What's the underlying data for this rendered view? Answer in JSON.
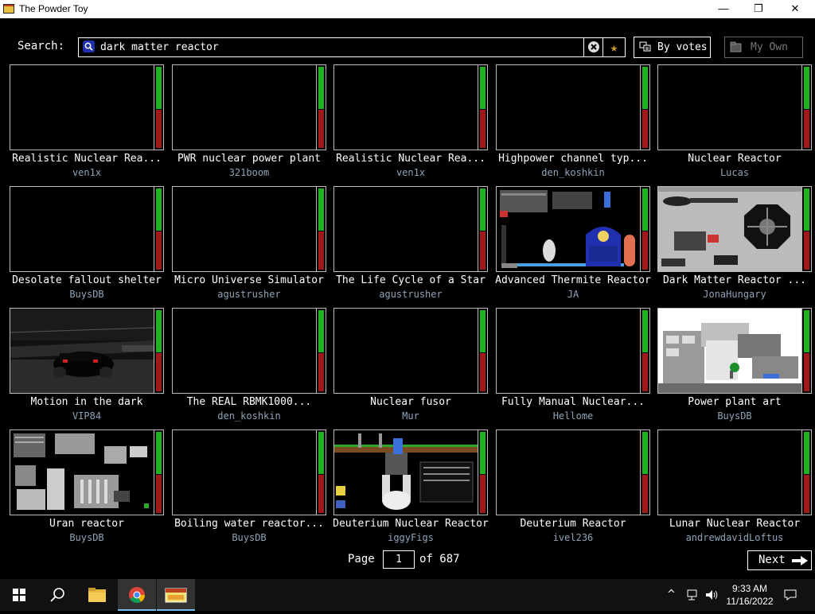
{
  "window": {
    "title": "The Powder Toy",
    "minimize": "—",
    "maximize": "❐",
    "close": "✕"
  },
  "search": {
    "label": "Search:",
    "query": "dark matter reactor",
    "sort_label": "By votes",
    "own_label": "My Own",
    "fav_glyph": "★"
  },
  "saves": [
    {
      "title": "Realistic Nuclear Rea...",
      "author": "ven1x",
      "thumb": "blank"
    },
    {
      "title": "PWR nuclear power plant",
      "author": "321boom",
      "thumb": "blank"
    },
    {
      "title": "Realistic Nuclear Rea...",
      "author": "ven1x",
      "thumb": "blank"
    },
    {
      "title": "Highpower channel typ...",
      "author": "den_koshkin",
      "thumb": "blank"
    },
    {
      "title": "Nuclear Reactor",
      "author": "Lucas",
      "thumb": "blank"
    },
    {
      "title": "Desolate fallout shelter",
      "author": "BuysDB",
      "thumb": "blank"
    },
    {
      "title": "Micro Universe Simulator",
      "author": "agustrusher",
      "thumb": "blank"
    },
    {
      "title": "The Life Cycle of a Star",
      "author": "agustrusher",
      "thumb": "blank"
    },
    {
      "title": "Advanced Thermite Reactor",
      "author": "JA",
      "thumb": "thermite-reactor"
    },
    {
      "title": "Dark Matter Reactor ...",
      "author": "JonaHungary",
      "thumb": "dark-matter-reactor"
    },
    {
      "title": "Motion in the dark",
      "author": "VIP84",
      "thumb": "car-dark"
    },
    {
      "title": "The REAL RBMK1000...",
      "author": "den_koshkin",
      "thumb": "blank"
    },
    {
      "title": "Nuclear fusor",
      "author": "Mur",
      "thumb": "blank"
    },
    {
      "title": "Fully Manual Nuclear...",
      "author": "Hellome",
      "thumb": "blank"
    },
    {
      "title": "Power plant art",
      "author": "BuysDB",
      "thumb": "power-plant-art"
    },
    {
      "title": "Uran reactor",
      "author": "BuysDB",
      "thumb": "uran-reactor"
    },
    {
      "title": "Boiling water reactor...",
      "author": "BuysDB",
      "thumb": "blank"
    },
    {
      "title": "Deuterium Nuclear Reactor",
      "author": "iggyFigs",
      "thumb": "deuterium-nuclear"
    },
    {
      "title": "Deuterium Reactor",
      "author": "ivel236",
      "thumb": "blank"
    },
    {
      "title": "Lunar Nuclear Reactor",
      "author": "andrewdavidLoftus",
      "thumb": "blank"
    }
  ],
  "pagination": {
    "page_label": "Page",
    "current_page": "1",
    "of_label": "of 687",
    "next_label": "Next"
  },
  "taskbar": {
    "clock_time": "9:33 AM",
    "clock_date": "11/16/2022"
  }
}
